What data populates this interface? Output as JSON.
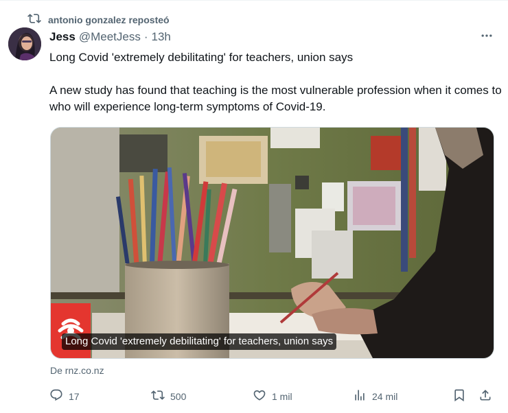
{
  "repost": {
    "label": "antonio gonzalez reposteó",
    "icon": "repost-icon"
  },
  "tweet": {
    "author_name": "Jess",
    "handle": "@MeetJess",
    "separator": "·",
    "time": "13h",
    "paragraphs": [
      "Long Covid 'extremely debilitating' for teachers, union says",
      "A new study has found that teaching is the most vulnerable profession when it comes to who will experience long-term symptoms of Covid-19."
    ]
  },
  "card": {
    "caption": "Long Covid 'extremely debilitating' for teachers, union says",
    "source": "De rnz.co.nz",
    "logo": "rnz-logo"
  },
  "actions": {
    "replies": "17",
    "reposts": "500",
    "likes": "1 mil",
    "views": "24 mil"
  },
  "colors": {
    "text_primary": "#0f1419",
    "text_secondary": "#536471",
    "rnz_red": "#e4362f"
  }
}
